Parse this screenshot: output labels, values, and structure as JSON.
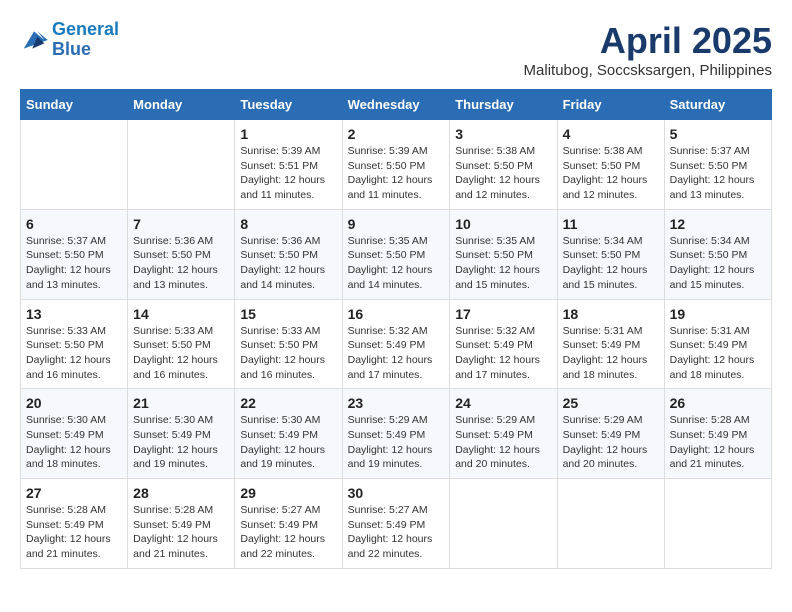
{
  "logo": {
    "line1": "General",
    "line2": "Blue"
  },
  "title": "April 2025",
  "subtitle": "Malitubog, Soccsksargen, Philippines",
  "header": {
    "days": [
      "Sunday",
      "Monday",
      "Tuesday",
      "Wednesday",
      "Thursday",
      "Friday",
      "Saturday"
    ]
  },
  "weeks": [
    {
      "cells": [
        {
          "empty": true
        },
        {
          "empty": true
        },
        {
          "day": "1",
          "sunrise": "Sunrise: 5:39 AM",
          "sunset": "Sunset: 5:51 PM",
          "daylight": "Daylight: 12 hours and 11 minutes."
        },
        {
          "day": "2",
          "sunrise": "Sunrise: 5:39 AM",
          "sunset": "Sunset: 5:50 PM",
          "daylight": "Daylight: 12 hours and 11 minutes."
        },
        {
          "day": "3",
          "sunrise": "Sunrise: 5:38 AM",
          "sunset": "Sunset: 5:50 PM",
          "daylight": "Daylight: 12 hours and 12 minutes."
        },
        {
          "day": "4",
          "sunrise": "Sunrise: 5:38 AM",
          "sunset": "Sunset: 5:50 PM",
          "daylight": "Daylight: 12 hours and 12 minutes."
        },
        {
          "day": "5",
          "sunrise": "Sunrise: 5:37 AM",
          "sunset": "Sunset: 5:50 PM",
          "daylight": "Daylight: 12 hours and 13 minutes."
        }
      ]
    },
    {
      "cells": [
        {
          "day": "6",
          "sunrise": "Sunrise: 5:37 AM",
          "sunset": "Sunset: 5:50 PM",
          "daylight": "Daylight: 12 hours and 13 minutes."
        },
        {
          "day": "7",
          "sunrise": "Sunrise: 5:36 AM",
          "sunset": "Sunset: 5:50 PM",
          "daylight": "Daylight: 12 hours and 13 minutes."
        },
        {
          "day": "8",
          "sunrise": "Sunrise: 5:36 AM",
          "sunset": "Sunset: 5:50 PM",
          "daylight": "Daylight: 12 hours and 14 minutes."
        },
        {
          "day": "9",
          "sunrise": "Sunrise: 5:35 AM",
          "sunset": "Sunset: 5:50 PM",
          "daylight": "Daylight: 12 hours and 14 minutes."
        },
        {
          "day": "10",
          "sunrise": "Sunrise: 5:35 AM",
          "sunset": "Sunset: 5:50 PM",
          "daylight": "Daylight: 12 hours and 15 minutes."
        },
        {
          "day": "11",
          "sunrise": "Sunrise: 5:34 AM",
          "sunset": "Sunset: 5:50 PM",
          "daylight": "Daylight: 12 hours and 15 minutes."
        },
        {
          "day": "12",
          "sunrise": "Sunrise: 5:34 AM",
          "sunset": "Sunset: 5:50 PM",
          "daylight": "Daylight: 12 hours and 15 minutes."
        }
      ]
    },
    {
      "cells": [
        {
          "day": "13",
          "sunrise": "Sunrise: 5:33 AM",
          "sunset": "Sunset: 5:50 PM",
          "daylight": "Daylight: 12 hours and 16 minutes."
        },
        {
          "day": "14",
          "sunrise": "Sunrise: 5:33 AM",
          "sunset": "Sunset: 5:50 PM",
          "daylight": "Daylight: 12 hours and 16 minutes."
        },
        {
          "day": "15",
          "sunrise": "Sunrise: 5:33 AM",
          "sunset": "Sunset: 5:50 PM",
          "daylight": "Daylight: 12 hours and 16 minutes."
        },
        {
          "day": "16",
          "sunrise": "Sunrise: 5:32 AM",
          "sunset": "Sunset: 5:49 PM",
          "daylight": "Daylight: 12 hours and 17 minutes."
        },
        {
          "day": "17",
          "sunrise": "Sunrise: 5:32 AM",
          "sunset": "Sunset: 5:49 PM",
          "daylight": "Daylight: 12 hours and 17 minutes."
        },
        {
          "day": "18",
          "sunrise": "Sunrise: 5:31 AM",
          "sunset": "Sunset: 5:49 PM",
          "daylight": "Daylight: 12 hours and 18 minutes."
        },
        {
          "day": "19",
          "sunrise": "Sunrise: 5:31 AM",
          "sunset": "Sunset: 5:49 PM",
          "daylight": "Daylight: 12 hours and 18 minutes."
        }
      ]
    },
    {
      "cells": [
        {
          "day": "20",
          "sunrise": "Sunrise: 5:30 AM",
          "sunset": "Sunset: 5:49 PM",
          "daylight": "Daylight: 12 hours and 18 minutes."
        },
        {
          "day": "21",
          "sunrise": "Sunrise: 5:30 AM",
          "sunset": "Sunset: 5:49 PM",
          "daylight": "Daylight: 12 hours and 19 minutes."
        },
        {
          "day": "22",
          "sunrise": "Sunrise: 5:30 AM",
          "sunset": "Sunset: 5:49 PM",
          "daylight": "Daylight: 12 hours and 19 minutes."
        },
        {
          "day": "23",
          "sunrise": "Sunrise: 5:29 AM",
          "sunset": "Sunset: 5:49 PM",
          "daylight": "Daylight: 12 hours and 19 minutes."
        },
        {
          "day": "24",
          "sunrise": "Sunrise: 5:29 AM",
          "sunset": "Sunset: 5:49 PM",
          "daylight": "Daylight: 12 hours and 20 minutes."
        },
        {
          "day": "25",
          "sunrise": "Sunrise: 5:29 AM",
          "sunset": "Sunset: 5:49 PM",
          "daylight": "Daylight: 12 hours and 20 minutes."
        },
        {
          "day": "26",
          "sunrise": "Sunrise: 5:28 AM",
          "sunset": "Sunset: 5:49 PM",
          "daylight": "Daylight: 12 hours and 21 minutes."
        }
      ]
    },
    {
      "cells": [
        {
          "day": "27",
          "sunrise": "Sunrise: 5:28 AM",
          "sunset": "Sunset: 5:49 PM",
          "daylight": "Daylight: 12 hours and 21 minutes."
        },
        {
          "day": "28",
          "sunrise": "Sunrise: 5:28 AM",
          "sunset": "Sunset: 5:49 PM",
          "daylight": "Daylight: 12 hours and 21 minutes."
        },
        {
          "day": "29",
          "sunrise": "Sunrise: 5:27 AM",
          "sunset": "Sunset: 5:49 PM",
          "daylight": "Daylight: 12 hours and 22 minutes."
        },
        {
          "day": "30",
          "sunrise": "Sunrise: 5:27 AM",
          "sunset": "Sunset: 5:49 PM",
          "daylight": "Daylight: 12 hours and 22 minutes."
        },
        {
          "empty": true
        },
        {
          "empty": true
        },
        {
          "empty": true
        }
      ]
    }
  ]
}
